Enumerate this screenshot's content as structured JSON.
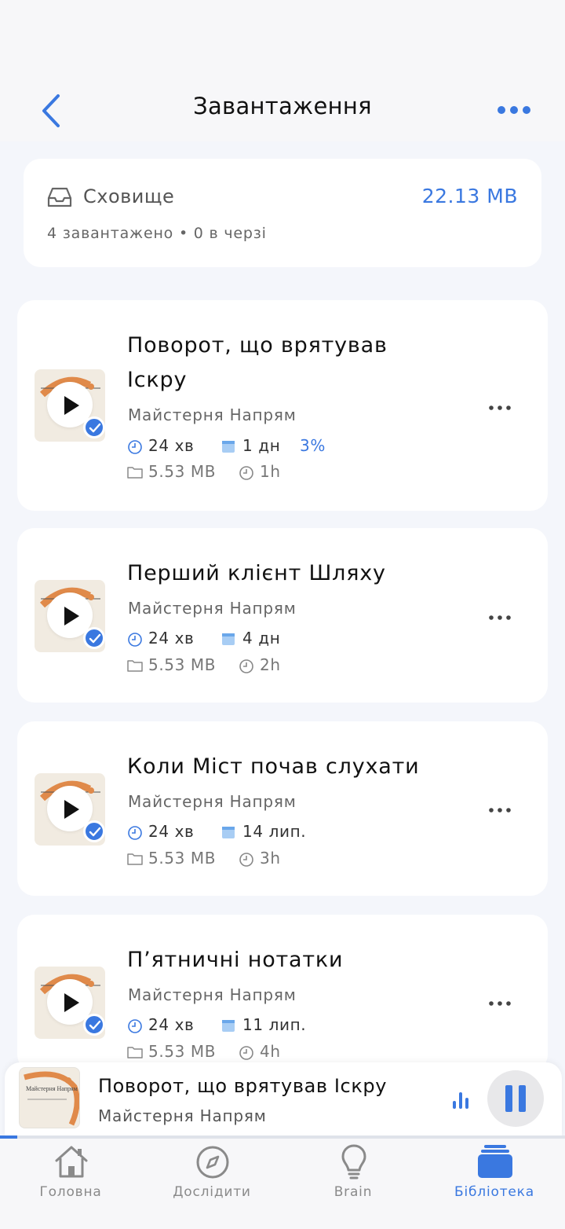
{
  "header": {
    "title": "Завантаження",
    "back_icon": "chevron-left-icon",
    "more_icon": "more-horizontal-icon",
    "accent_color": "#3a78e0"
  },
  "storage": {
    "label": "Сховище",
    "size": "22.13 MB",
    "summary": "4 завантажено • 0 в черзі",
    "icon": "tray-icon"
  },
  "episodes": [
    {
      "title": "Поворот, що врятував Іскру",
      "author": "Майстерня Напрям",
      "duration": "24 хв",
      "date": "1 дн",
      "progress": "3%",
      "size": "5.53 MB",
      "time": "1h"
    },
    {
      "title": "Перший клієнт Шляху",
      "author": "Майстерня Напрям",
      "duration": "24 хв",
      "date": "4 дн",
      "size": "5.53 MB",
      "time": "2h"
    },
    {
      "title": "Коли Міст почав слухати",
      "author": "Майстерня Напрям",
      "duration": "24 хв",
      "date": "14 лип.",
      "size": "5.53 MB",
      "time": "3h"
    },
    {
      "title": "П’ятничні нотатки",
      "author": "Майстерня Напрям",
      "duration": "24 хв",
      "date": "11 лип.",
      "size": "5.53 MB",
      "time": "4h"
    }
  ],
  "mini_player": {
    "title": "Поворот, що врятував Іскру",
    "author": "Майстерня Напрям",
    "cover_text": "Майстерня Напрям",
    "progress_fraction": 0.03,
    "state": "playing"
  },
  "tabs": [
    {
      "label": "Головна",
      "icon": "home-icon",
      "active": false
    },
    {
      "label": "Дослідити",
      "icon": "compass-icon",
      "active": false
    },
    {
      "label": "Brain",
      "icon": "lightbulb-icon",
      "active": false
    },
    {
      "label": "Бібліотека",
      "icon": "library-icon",
      "active": true
    }
  ]
}
